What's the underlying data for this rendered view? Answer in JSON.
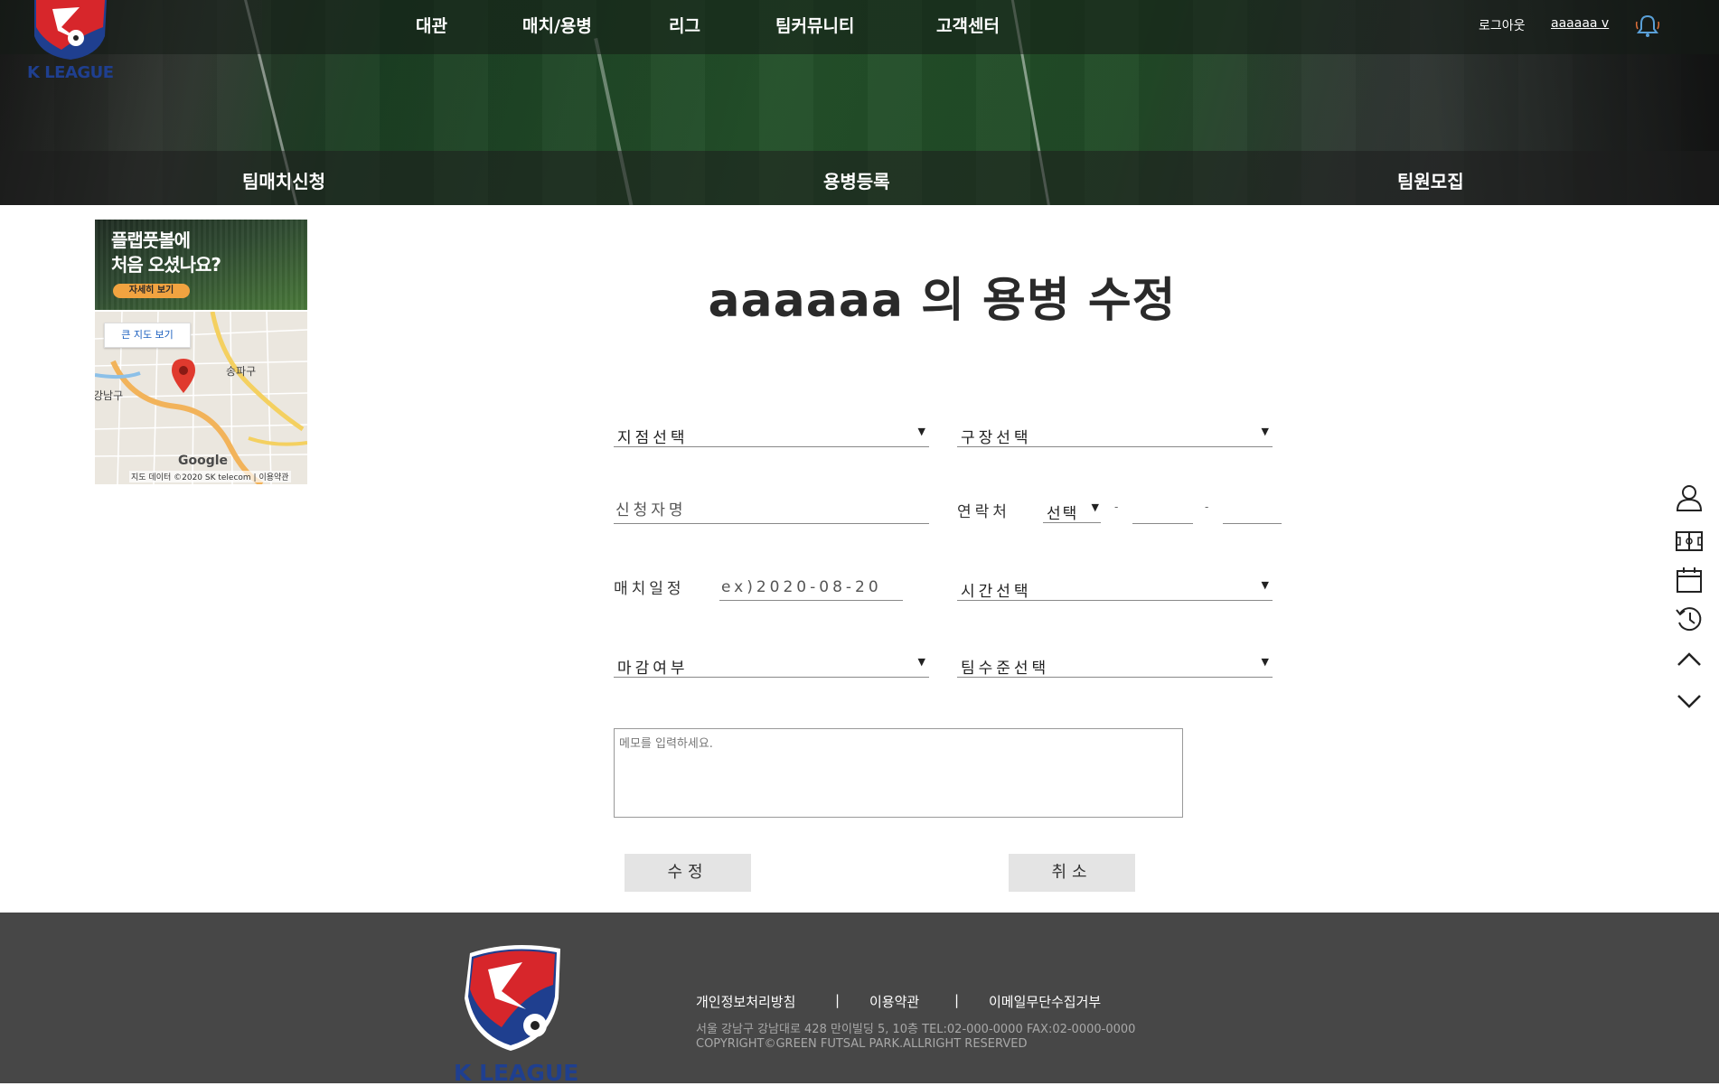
{
  "header": {
    "logo_text": "K LEAGUE",
    "nav": [
      "대관",
      "매치/용병",
      "리그",
      "팀커뮤니티",
      "고객센터"
    ],
    "logout": "로그아웃",
    "username": "aaaaaa v",
    "subnav": [
      "팀매치신청",
      "용병등록",
      "팀원모집"
    ]
  },
  "sidebar": {
    "ad_line1": "플랩풋볼에",
    "ad_line2": "처음 오셨나요?",
    "ad_button": "자세히 보기",
    "map": {
      "big_map_button": "큰 지도 보기",
      "label_songpa": "송파구",
      "label_gangnam": "강남구",
      "google": "Google",
      "attribution": "지도 데이터 ©2020 SK telecom | 이용약관"
    }
  },
  "form": {
    "title": "aaaaaa 의 용병 수정",
    "branch_select": "지점선택",
    "field_select": "구장선택",
    "applicant_placeholder": "신청자명",
    "contact_label": "연락처",
    "phone_prefix": "선택",
    "phone_dash": "-",
    "match_date_label": "매치일정",
    "match_date_placeholder": "ex)2020-08-20",
    "time_select": "시간선택",
    "deadline_select": "마감여부",
    "team_level_select": "팀수준선택",
    "memo_placeholder": "메모를 입력하세요.",
    "submit": "수정",
    "cancel": "취소"
  },
  "quick_menu": [
    "user-icon",
    "stadium-icon",
    "calendar-icon",
    "history-icon",
    "arrow-up-icon",
    "arrow-down-icon"
  ],
  "footer": {
    "logo_text": "K LEAGUE",
    "privacy": "개인정보처리방침",
    "separator": "|",
    "terms": "이용약관",
    "email_refuse": "이메일무단수집거부",
    "address": "서울 강남구 강남대로 428 만이빌딩 5, 10층 TEL:02-000-0000 FAX:02-0000-0000",
    "copyright": "COPYRIGHT©GREEN FUTSAL PARK.ALLRIGHT RESERVED"
  },
  "colors": {
    "footer_bg": "#474747",
    "button_bg": "#e4e4e4",
    "logo_red": "#d7262b",
    "logo_blue": "#1f3f8f",
    "ad_accent": "#f1a340"
  }
}
